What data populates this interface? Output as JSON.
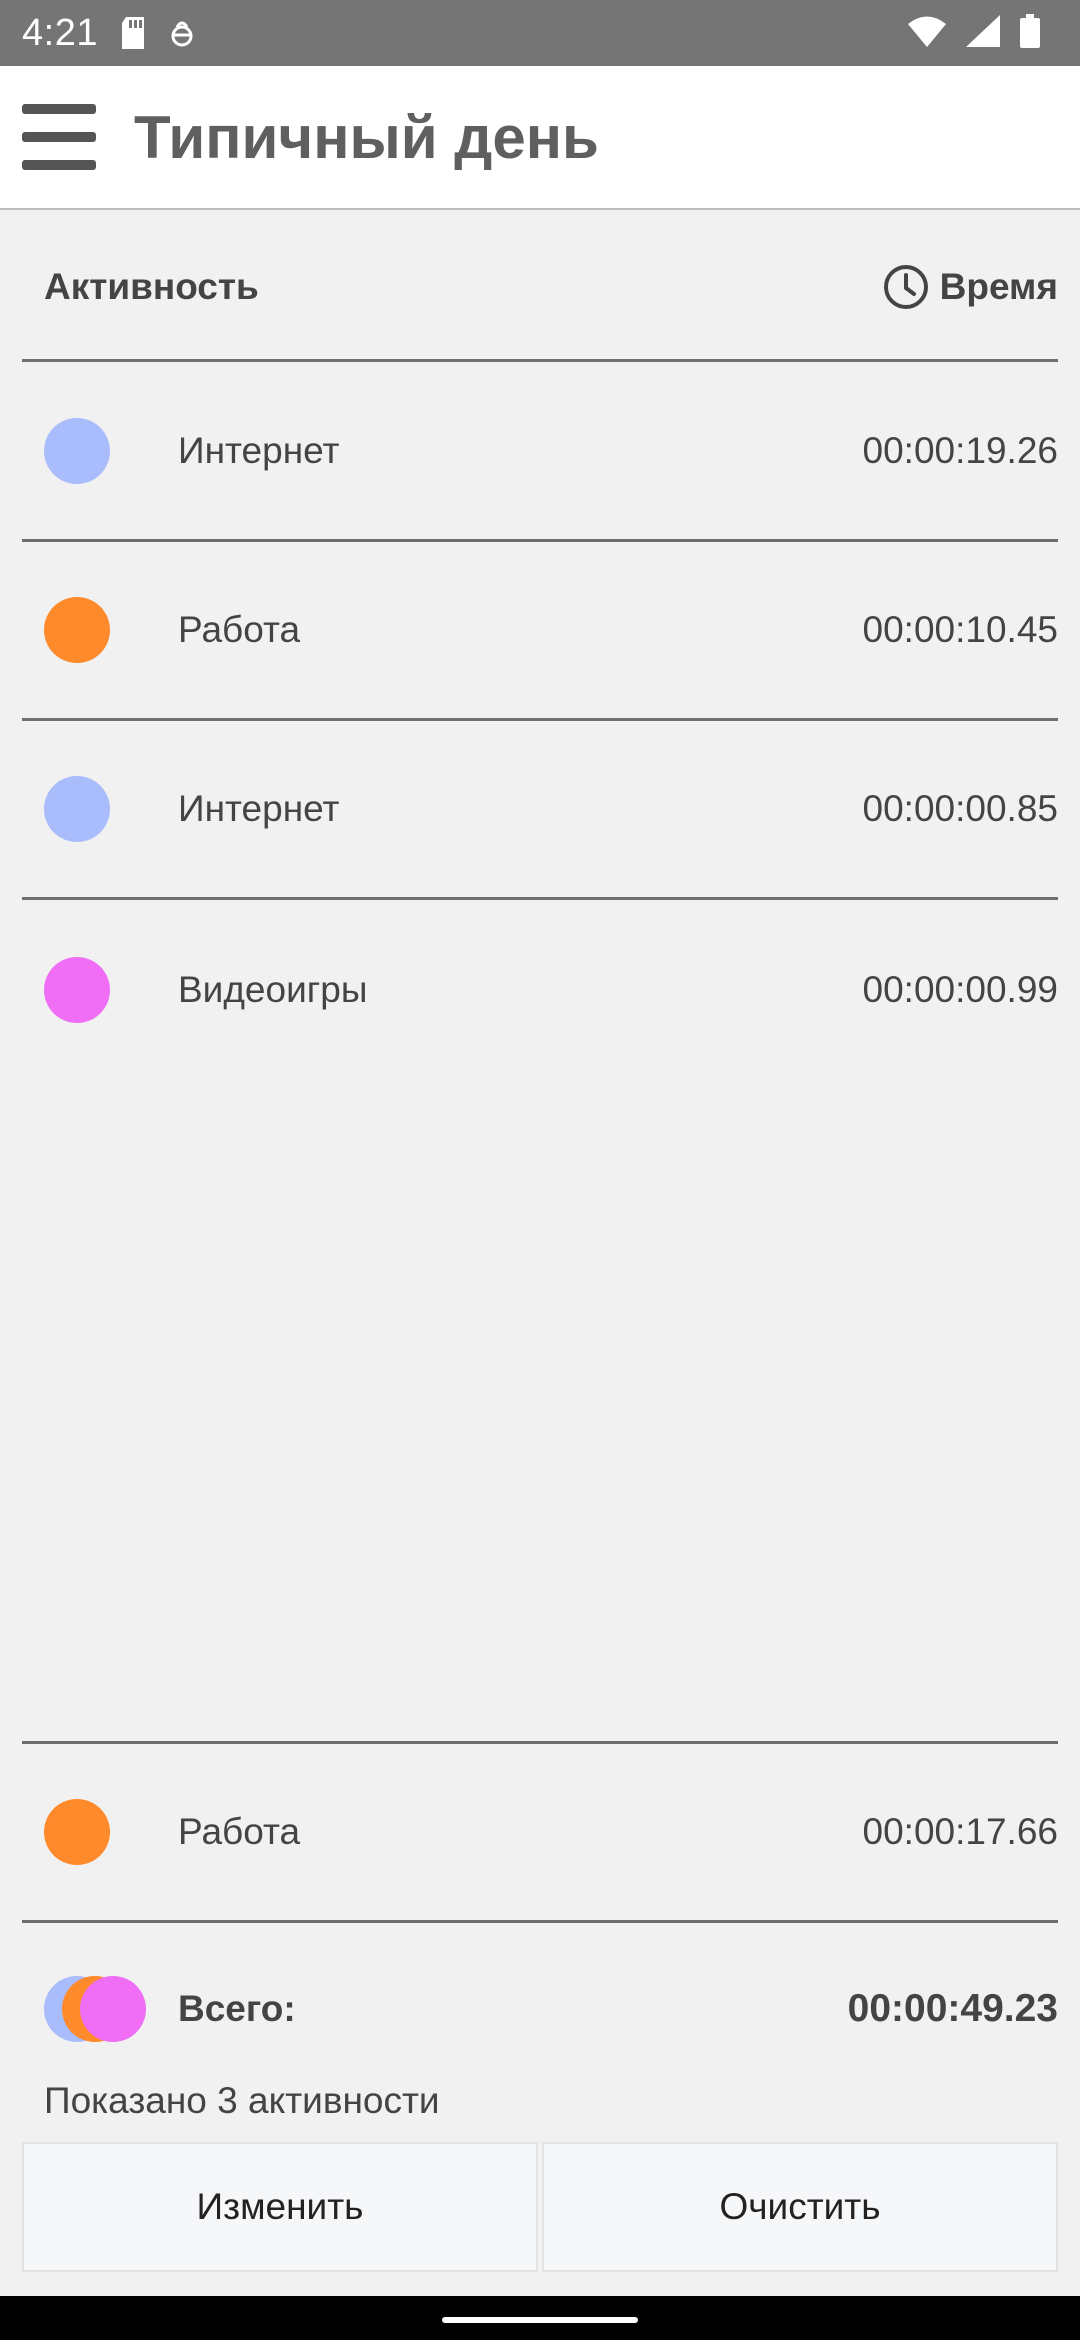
{
  "status_bar": {
    "time": "4:21",
    "icons_left": [
      "sd-card-icon",
      "debug-icon"
    ],
    "icons_right": [
      "wifi-icon",
      "signal-icon",
      "battery-icon"
    ]
  },
  "app_bar": {
    "title": "Типичный день",
    "menu_icon": "hamburger-menu-icon"
  },
  "table_header": {
    "activity_label": "Активность",
    "time_label": "Время",
    "time_icon": "clock-icon"
  },
  "rows": [
    {
      "label": "Интернет",
      "value": "00:00:19.26",
      "color": "#a9bcfb"
    },
    {
      "label": "Работа",
      "value": "00:00:10.45",
      "color": "#fe8a2b"
    },
    {
      "label": "Интернет",
      "value": "00:00:00.85",
      "color": "#a9bcfb"
    },
    {
      "label": "Видеоигры",
      "value": "00:00:00.99",
      "color": "#ef6ef5"
    }
  ],
  "current_row": {
    "label": "Работа",
    "value": "00:00:17.66",
    "color": "#fe8a2b"
  },
  "total": {
    "label": "Всего:",
    "value": "00:00:49.23",
    "colors": [
      "#a9bcfb",
      "#fe8a2b",
      "#ef6ef5"
    ]
  },
  "shown_text": "Показано 3 активности",
  "buttons": {
    "edit": "Изменить",
    "clear": "Очистить"
  }
}
